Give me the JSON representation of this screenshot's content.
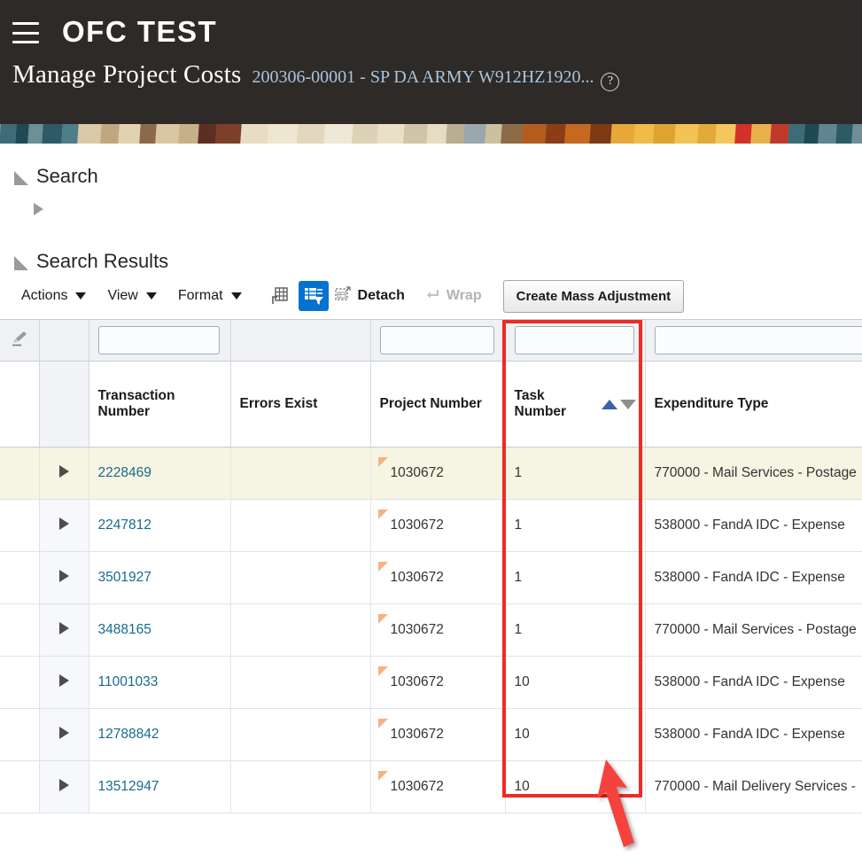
{
  "header": {
    "menu_icon": "hamburger-menu-icon",
    "brand": "OFC TEST",
    "page_title": "Manage Project Costs",
    "page_subtitle": "200306-00001 - SP DA ARMY W912HZ1920...",
    "help_icon": "help-question-icon",
    "background": "#2e2a27",
    "subtitle_color": "#a9c5de"
  },
  "sections": {
    "search": {
      "label": "Search",
      "expanded": true
    },
    "search_results": {
      "label": "Search Results",
      "expanded": true
    }
  },
  "toolbar": {
    "actions_label": "Actions",
    "view_label": "View",
    "format_label": "Format",
    "export_icon": "export-to-excel-icon",
    "query_filter_icon": "query-by-example-filter-icon",
    "query_filter_active": true,
    "query_filter_color": "#0572ce",
    "detach_icon": "detach-icon",
    "detach_label": "Detach",
    "wrap_icon": "wrap-text-icon",
    "wrap_label": "Wrap",
    "wrap_disabled": true,
    "mass_adjustment_label": "Create Mass Adjustment"
  },
  "table": {
    "clear_filter_icon": "clear-filter-brush-icon",
    "columns": [
      {
        "key": "select",
        "label": ""
      },
      {
        "key": "expand",
        "label": ""
      },
      {
        "key": "transaction_number",
        "label": "Transaction Number",
        "filter_value": "",
        "has_filter": true
      },
      {
        "key": "errors_exist",
        "label": "Errors Exist",
        "filter_value": "",
        "has_filter": false
      },
      {
        "key": "project_number",
        "label": "Project Number",
        "filter_value": "",
        "has_filter": true
      },
      {
        "key": "task_number",
        "label": "Task Number",
        "filter_value": "",
        "has_filter": true,
        "sorted": "ascending"
      },
      {
        "key": "expenditure_type",
        "label": "Expenditure Type",
        "filter_value": "",
        "has_filter": true
      }
    ],
    "sort_icons": {
      "ascending": "sort-ascending-icon",
      "descending": "sort-descending-icon"
    },
    "row_expander_icon": "row-expand-triangle-icon",
    "required_flag_icon": "required-field-corner-icon",
    "rows": [
      {
        "transaction_number": "2228469",
        "errors_exist": "",
        "project_number": "1030672",
        "task_number": "1",
        "expenditure_type": "770000 - Mail Services - Postage",
        "highlighted": true
      },
      {
        "transaction_number": "2247812",
        "errors_exist": "",
        "project_number": "1030672",
        "task_number": "1",
        "expenditure_type": "538000 - FandA IDC - Expense",
        "highlighted": false
      },
      {
        "transaction_number": "3501927",
        "errors_exist": "",
        "project_number": "1030672",
        "task_number": "1",
        "expenditure_type": "538000 - FandA IDC - Expense",
        "highlighted": false
      },
      {
        "transaction_number": "3488165",
        "errors_exist": "",
        "project_number": "1030672",
        "task_number": "1",
        "expenditure_type": "770000 - Mail Services - Postage",
        "highlighted": false
      },
      {
        "transaction_number": "11001033",
        "errors_exist": "",
        "project_number": "1030672",
        "task_number": "10",
        "expenditure_type": "538000 - FandA IDC - Expense",
        "highlighted": false
      },
      {
        "transaction_number": "12788842",
        "errors_exist": "",
        "project_number": "1030672",
        "task_number": "10",
        "expenditure_type": "538000 - FandA IDC - Expense",
        "highlighted": false
      },
      {
        "transaction_number": "13512947",
        "errors_exist": "",
        "project_number": "1030672",
        "task_number": "10",
        "expenditure_type": "770000 - Mail Delivery Services -",
        "highlighted": false
      }
    ]
  },
  "annotations": {
    "highlight_box": {
      "target_column": "task_number",
      "color": "#ee2b25"
    },
    "pointer_arrow": {
      "target": "task-number-sort-ascending",
      "color": "#f5433d"
    }
  },
  "colors": {
    "link": "#186b8c",
    "row_highlight": "#f6f5e3",
    "filter_bar": "#eff1f5",
    "required_flag": "#f5b183",
    "sort_active": "#3d62a8"
  }
}
